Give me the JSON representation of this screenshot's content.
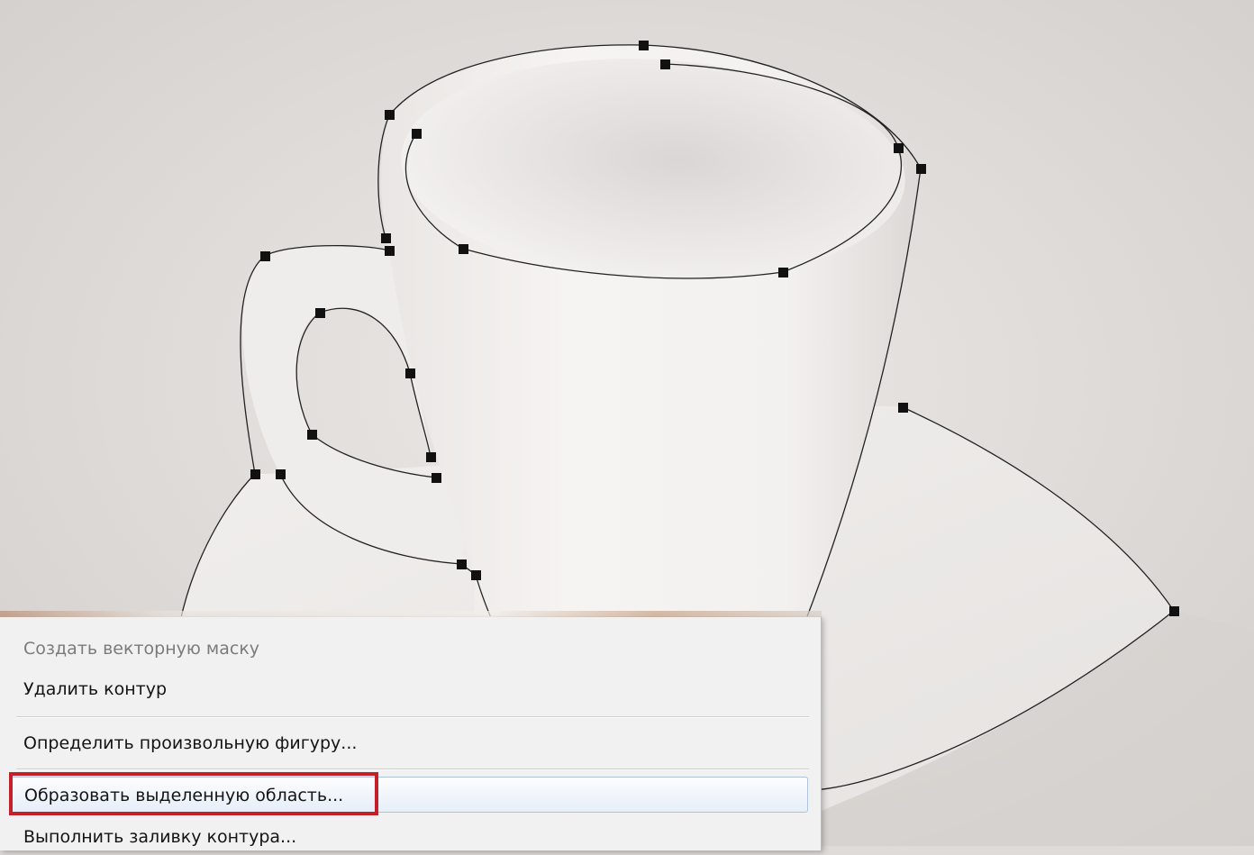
{
  "canvas": {
    "subject": "cup-and-saucer-photo",
    "path_color": "#222222",
    "anchor_color": "#111111"
  },
  "context_menu": {
    "items": [
      {
        "label": "Создать векторную маску",
        "disabled": true
      },
      {
        "label": "Удалить контур",
        "disabled": false
      },
      {
        "label": "Определить произвольную фигуру...",
        "disabled": false
      },
      {
        "label": "Образовать выделенную область...",
        "disabled": false,
        "highlighted": true
      },
      {
        "label": "Выполнить заливку контура...",
        "disabled": false
      }
    ],
    "highlight_color": "#c3202a"
  }
}
